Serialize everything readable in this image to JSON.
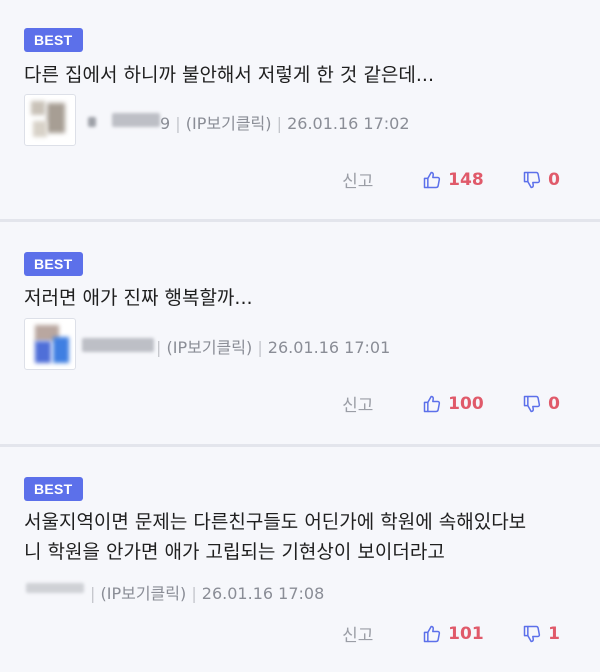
{
  "comments": [
    {
      "badge": "BEST",
      "text_lines": [
        "다른 집에서 하니까 불안해서 저렇게 한 것 같은데..."
      ],
      "author_suffix": "9",
      "ip_label": "(IP보기클릭)",
      "date": "26.01.16 17:02",
      "report_label": "신고",
      "likes": "148",
      "dislikes": "0"
    },
    {
      "badge": "BEST",
      "text_lines": [
        "저러면 애가 진짜 행복할까..."
      ],
      "author_suffix": "",
      "ip_label": "(IP보기클릭)",
      "date": "26.01.16 17:01",
      "report_label": "신고",
      "likes": "100",
      "dislikes": "0"
    },
    {
      "badge": "BEST",
      "text_lines": [
        "서울지역이면 문제는 다른친구들도 어딘가에 학원에 속해있다보",
        "니 학원을 안가면 애가 고립되는 기현상이 보이더라고"
      ],
      "author_suffix": "",
      "ip_label": "(IP보기클릭)",
      "date": "26.01.16 17:08",
      "report_label": "신고",
      "likes": "101",
      "dislikes": "1"
    }
  ],
  "separator": "|",
  "colors": {
    "badge": "#5c70ea",
    "vote": "#e05a6a",
    "icon": "#5c70ea",
    "background": "#f6f7fb"
  },
  "icons": {
    "like": "thumbs-up-icon",
    "dislike": "thumbs-down-icon"
  }
}
